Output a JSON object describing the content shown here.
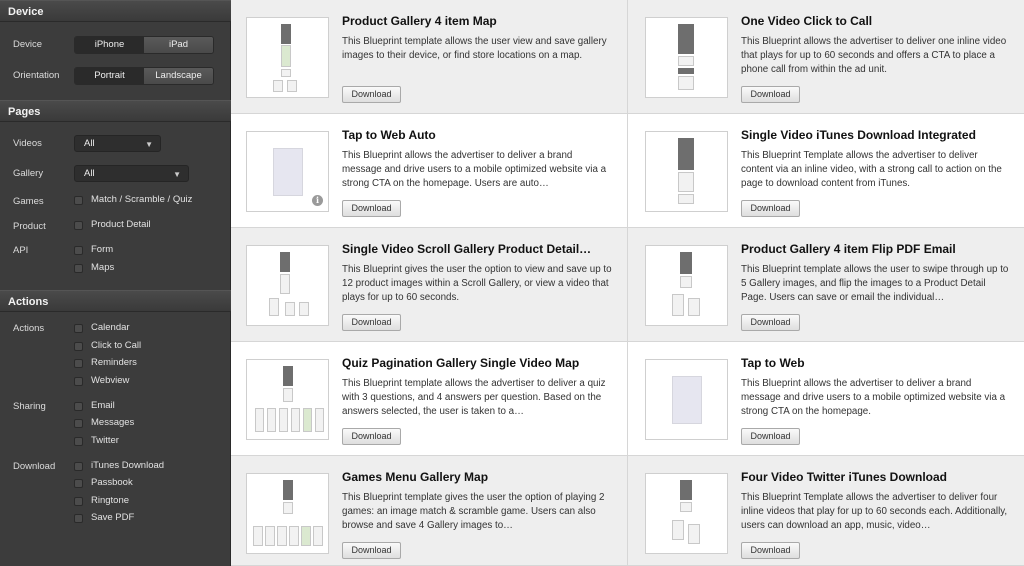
{
  "sidebar": {
    "device": {
      "header": "Device",
      "device_label": "Device",
      "iphone": "iPhone",
      "ipad": "iPad",
      "orientation_label": "Orientation",
      "portrait": "Portrait",
      "landscape": "Landscape"
    },
    "pages": {
      "header": "Pages",
      "videos_label": "Videos",
      "videos_value": "All",
      "gallery_label": "Gallery",
      "gallery_value": "All",
      "games_label": "Games",
      "games_option": "Match / Scramble / Quiz",
      "product_label": "Product",
      "product_option": "Product Detail",
      "api_label": "API",
      "api_options": [
        "Form",
        "Maps"
      ]
    },
    "actions": {
      "header": "Actions",
      "actions_label": "Actions",
      "actions_options": [
        "Calendar",
        "Click to Call",
        "Reminders",
        "Webview"
      ],
      "sharing_label": "Sharing",
      "sharing_options": [
        "Email",
        "Messages",
        "Twitter"
      ],
      "download_label": "Download",
      "download_options": [
        "iTunes Download",
        "Passbook",
        "Ringtone",
        "Save PDF"
      ]
    }
  },
  "cards": [
    {
      "title": "Product Gallery 4 item Map",
      "desc": "This Blueprint template allows the user view and save gallery images to their device, or find store locations on a map.",
      "button": "Download"
    },
    {
      "title": "One Video Click to Call",
      "desc": "This Blueprint allows the advertiser to deliver one inline video that plays for up to 60 seconds and offers a CTA to place a phone call from within the ad unit.",
      "button": "Download"
    },
    {
      "title": "Tap to Web Auto",
      "desc": "This Blueprint allows the advertiser to deliver a brand message and drive users to a mobile optimized website via a strong CTA on the homepage. Users are auto…",
      "button": "Download"
    },
    {
      "title": "Single Video iTunes Download Integrated",
      "desc": "This Blueprint Template allows the advertiser to deliver content via an inline video, with a strong call to action on the page to download content from iTunes.",
      "button": "Download"
    },
    {
      "title": "Single Video Scroll Gallery Product Detail…",
      "desc": "This Blueprint gives the user the option to view and save up to 12 product images within a Scroll Gallery, or view a video that plays for up to 60 seconds.",
      "button": "Download"
    },
    {
      "title": "Product Gallery 4 item Flip PDF Email",
      "desc": "This Blueprint template allows the user to swipe through up to 5 Gallery images, and flip the images to a Product Detail Page. Users can save or email the individual…",
      "button": "Download"
    },
    {
      "title": "Quiz Pagination Gallery Single Video Map",
      "desc": "This Blueprint template allows the advertiser to deliver a quiz with 3 questions, and 4 answers per question. Based on the answers selected, the user is taken to a…",
      "button": "Download"
    },
    {
      "title": "Tap to Web",
      "desc": "This Blueprint allows the advertiser to deliver a brand message and drive users to a mobile optimized website via a strong CTA on the homepage.",
      "button": "Download"
    },
    {
      "title": "Games Menu Gallery Map",
      "desc": "This Blueprint template gives the user the option of playing 2 games: an image match & scramble game. Users can also browse and save 4 Gallery images to…",
      "button": "Download"
    },
    {
      "title": "Four Video Twitter iTunes Download",
      "desc": "This Blueprint Template allows the advertiser to deliver four inline videos that play for up to 60 seconds each. Additionally, users can download an app, music, video…",
      "button": "Download"
    }
  ],
  "info_glyph": "i"
}
